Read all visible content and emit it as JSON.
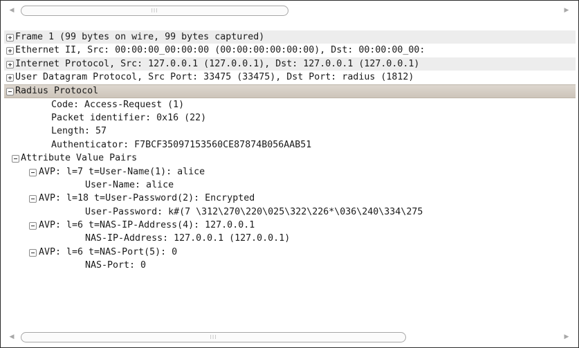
{
  "scroll_arrows": {
    "left": "◀",
    "right": "▶"
  },
  "scroll_grip": "III",
  "tree": {
    "frame": "Frame 1 (99 bytes on wire, 99 bytes captured)",
    "ethernet": "Ethernet II, Src: 00:00:00_00:00:00 (00:00:00:00:00:00), Dst: 00:00:00_00:",
    "ip": "Internet Protocol, Src: 127.0.0.1 (127.0.0.1), Dst: 127.0.0.1 (127.0.0.1)",
    "udp": "User Datagram Protocol, Src Port: 33475 (33475), Dst Port: radius (1812)",
    "radius": "Radius Protocol",
    "code": "Code: Access-Request (1)",
    "packet_id": "Packet identifier: 0x16 (22)",
    "length": "Length: 57",
    "authenticator": "Authenticator: F7BCF35097153560CE87874B056AAB51",
    "avp_header": "Attribute Value Pairs",
    "avp1": "AVP: l=7  t=User-Name(1): alice",
    "avp1_val": "User-Name: alice",
    "avp2": "AVP: l=18  t=User-Password(2): Encrypted",
    "avp2_val": "User-Password: k#(7 \\312\\270\\220\\025\\322\\226*\\036\\240\\334\\275",
    "avp3": "AVP: l=6  t=NAS-IP-Address(4): 127.0.0.1",
    "avp3_val": "NAS-IP-Address: 127.0.0.1 (127.0.0.1)",
    "avp4": "AVP: l=6  t=NAS-Port(5): 0",
    "avp4_val": "NAS-Port: 0"
  }
}
